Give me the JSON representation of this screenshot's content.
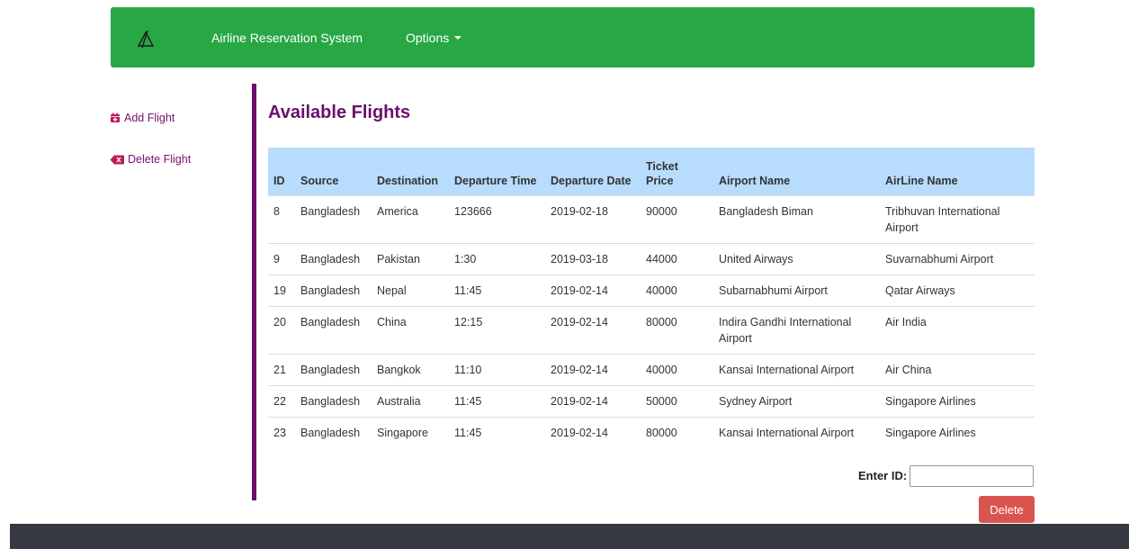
{
  "navbar": {
    "brand": "Airline Reservation System",
    "options_label": "Options",
    "logo_icon": "airline-logo-icon",
    "color": "#28a745"
  },
  "sidebar": {
    "items": [
      {
        "label": "Add Flight",
        "icon": "calendar-plus-icon"
      },
      {
        "label": "Delete Flight",
        "icon": "backspace-icon"
      }
    ]
  },
  "main": {
    "title": "Available Flights",
    "accent": "#6b0f6b",
    "table": {
      "columns": [
        "ID",
        "Source",
        "Destination",
        "Departure Time",
        "Departure Date",
        "Ticket Price",
        "Airport Name",
        "AirLine Name"
      ],
      "rows": [
        [
          "8",
          "Bangladesh",
          "America",
          "123666",
          "2019-02-18",
          "90000",
          "Bangladesh Biman",
          "Tribhuvan International Airport"
        ],
        [
          "9",
          "Bangladesh",
          "Pakistan",
          "1:30",
          "2019-03-18",
          "44000",
          "United Airways",
          "Suvarnabhumi Airport"
        ],
        [
          "19",
          "Bangladesh",
          "Nepal",
          "11:45",
          "2019-02-14",
          "40000",
          "Subarnabhumi Airport",
          "Qatar Airways"
        ],
        [
          "20",
          "Bangladesh",
          "China",
          "12:15",
          "2019-02-14",
          "80000",
          "Indira Gandhi International Airport",
          "Air India"
        ],
        [
          "21",
          "Bangladesh",
          "Bangkok",
          "11:10",
          "2019-02-14",
          "40000",
          "Kansai International Airport",
          "Air China"
        ],
        [
          "22",
          "Bangladesh",
          "Australia",
          "11:45",
          "2019-02-14",
          "50000",
          "Sydney Airport",
          "Singapore Airlines"
        ],
        [
          "23",
          "Bangladesh",
          "Singapore",
          "11:45",
          "2019-02-14",
          "80000",
          "Kansai International Airport",
          "Singapore Airlines"
        ]
      ]
    },
    "delete_form": {
      "id_label": "Enter ID:",
      "id_value": "",
      "button_label": "Delete",
      "button_color": "#d9534f"
    }
  }
}
